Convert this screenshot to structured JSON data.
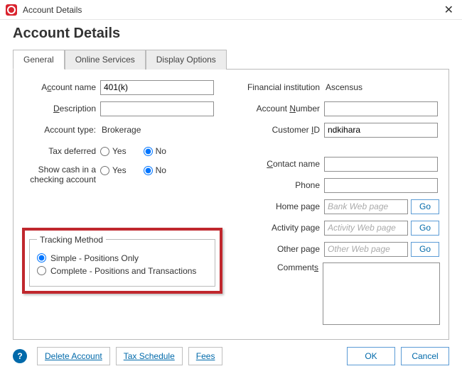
{
  "titlebar": {
    "title": "Account Details"
  },
  "header": {
    "title": "Account Details"
  },
  "tabs": {
    "general": "General",
    "online": "Online Services",
    "display": "Display Options"
  },
  "left": {
    "account_name_label_pre": "A",
    "account_name_label_u": "c",
    "account_name_label_post": "count name",
    "account_name_value": "401(k)",
    "description_label_pre": "",
    "description_label_u": "D",
    "description_label_post": "escription",
    "description_value": "",
    "account_type_label": "Account type:",
    "account_type_value": "Brokerage",
    "tax_deferred_label": "Tax deferred",
    "yes_label_u": "Y",
    "yes_label_post": "es",
    "no_label": "No",
    "tax_deferred_value": "no",
    "show_cash_label": "Show cash in a checking account",
    "show_cash_yes": "Yes",
    "show_cash_no": "No",
    "show_cash_value": "no"
  },
  "tracking": {
    "legend": "Tracking Method",
    "simple": "Simple - Positions Only",
    "complete": "Complete - Positions and Transactions",
    "value": "simple"
  },
  "right": {
    "fin_inst_label": "Financial institution",
    "fin_inst_value": "Ascensus",
    "acct_num_label_pre": "Account ",
    "acct_num_label_u": "N",
    "acct_num_label_post": "umber",
    "acct_num_value": "",
    "cust_id_label_pre": "Customer ",
    "cust_id_label_u": "I",
    "cust_id_label_post": "D",
    "cust_id_value": "ndkihara",
    "contact_label_u": "C",
    "contact_label_post": "ontact name",
    "contact_value": "",
    "phone_label": "Phone",
    "phone_value": "",
    "home_page_label": "Home page",
    "home_page_placeholder": "Bank Web page",
    "activity_page_label": "Activity page",
    "activity_page_placeholder": "Activity Web page",
    "other_page_label": "Other page",
    "other_page_placeholder": "Other Web page",
    "go": "Go",
    "comments_label_pre": "Comment",
    "comments_label_u": "s",
    "comments_value": ""
  },
  "footer": {
    "delete": "Delete Account",
    "tax": "Tax Schedule",
    "fees": "Fees",
    "ok": "OK",
    "cancel": "Cancel"
  }
}
